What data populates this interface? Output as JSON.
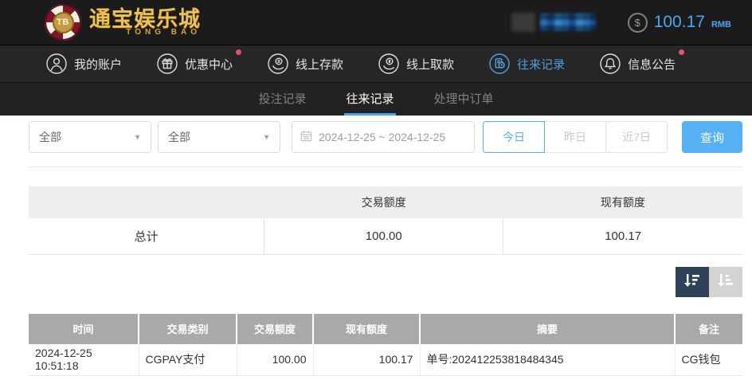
{
  "header": {
    "logo": {
      "chip_text": "TB",
      "brand_cn": "通宝娱乐城",
      "brand_en": "TONG BAO"
    },
    "balance": {
      "currency_symbol": "$",
      "amount": "100.17",
      "unit": "RMB"
    }
  },
  "nav": {
    "items": [
      {
        "label": "我的账户",
        "icon": "user-icon",
        "active": false,
        "badge": false
      },
      {
        "label": "优惠中心",
        "icon": "gift-icon",
        "active": false,
        "badge": true
      },
      {
        "label": "线上存款",
        "icon": "deposit-icon",
        "active": false,
        "badge": false
      },
      {
        "label": "线上取款",
        "icon": "withdraw-icon",
        "active": false,
        "badge": false
      },
      {
        "label": "往来记录",
        "icon": "records-icon",
        "active": true,
        "badge": false
      },
      {
        "label": "信息公告",
        "icon": "bell-icon",
        "active": false,
        "badge": true
      }
    ]
  },
  "tabs": [
    {
      "label": "投注记录",
      "active": false
    },
    {
      "label": "往来记录",
      "active": true
    },
    {
      "label": "处理中订单",
      "active": false
    }
  ],
  "filters": {
    "type_filter_1": "全部",
    "type_filter_2": "全部",
    "date_range": "2024-12-25 ~ 2024-12-25",
    "quick": [
      {
        "label": "今日",
        "active": true
      },
      {
        "label": "昨日",
        "active": false
      },
      {
        "label": "近7日",
        "active": false
      }
    ],
    "search_label": "查询"
  },
  "summary_table": {
    "headers": [
      "",
      "交易额度",
      "现有额度"
    ],
    "rows": [
      [
        "总计",
        "100.00",
        "100.17"
      ]
    ]
  },
  "detail_table": {
    "headers": [
      "时间",
      "交易类别",
      "交易额度",
      "现有额度",
      "摘要",
      "备注"
    ],
    "rows": [
      [
        "2024-12-25 10:51:18",
        "CGPAY支付",
        "100.00",
        "100.17",
        "单号:202412253818484345",
        "CG钱包"
      ]
    ]
  },
  "colors": {
    "accent_blue": "#4da3e8",
    "button_blue": "#57b0f2",
    "badge_red": "#ed4d6e",
    "gold": "#ecc258",
    "table_header_gray": "#a9a9a9",
    "sort_dark": "#2e4156",
    "sort_light": "#d3d3d3"
  }
}
